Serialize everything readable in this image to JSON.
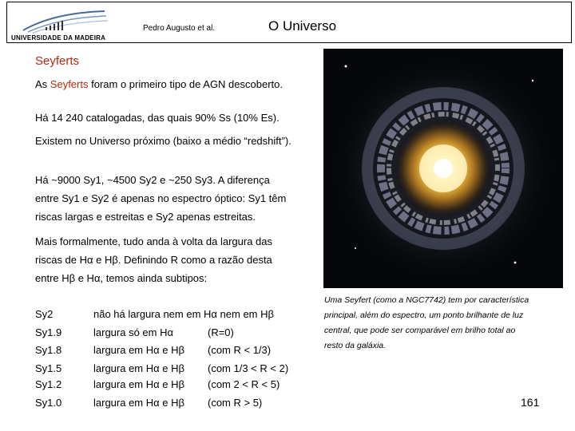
{
  "header": {
    "logo_text": "UNIVERSIDADE DA MADEIRA",
    "author": "Pedro Augusto et al.",
    "title": "O Universo"
  },
  "section_title": "Seyferts",
  "paragraphs": {
    "p1_pre": "As ",
    "p1_highlight": "Seyferts",
    "p1_post": " foram o primeiro tipo de AGN descoberto.",
    "p2": "Há 14 240 catalogadas, das quais 90% Ss (10% Es).",
    "p3": "Existem no Universo próximo (baixo a médio “redshift”).",
    "p4_lines": [
      "Há ~9000 Sy1, ~4500 Sy2 e ~250 Sy3. A diferença",
      "entre Sy1 e Sy2 é apenas no espectro óptico: Sy1 têm",
      "riscas largas e estreitas e Sy2 apenas estreitas."
    ],
    "p5_lines": [
      "Mais formalmente, tudo anda à volta da largura das",
      "riscas de Hα e Hβ. Definindo R como a razão desta",
      "entre Hβ e Hα, temos ainda subtipos:"
    ]
  },
  "subtypes": [
    {
      "name": "Sy2",
      "description": "não há largura nem em Hα nem em Hβ",
      "ratio": ""
    },
    {
      "name": "Sy1.9",
      "description": "largura só em Hα",
      "ratio": "(R=0)"
    },
    {
      "name": "Sy1.8",
      "description": "largura em Hα e Hβ",
      "ratio": "(com R < 1/3)"
    },
    {
      "name": "Sy1.5",
      "description": "largura em Hα e Hβ",
      "ratio": "(com 1/3 < R < 2)"
    },
    {
      "name": "Sy1.2",
      "description": "largura em Hα e Hβ",
      "ratio": "(com 2 < R < 5)"
    },
    {
      "name": "Sy1.0",
      "description": "largura em Hα e Hβ",
      "ratio": "(com R > 5)"
    }
  ],
  "caption_lines": [
    "Uma Seyfert (como a NGC7742) tem por característica",
    "principal, além do espectro, um ponto brilhante de luz",
    "central, que pode ser comparável em brilho total ao",
    "resto da galáxia."
  ],
  "page_number": "161",
  "colors": {
    "highlight": "#b22a10",
    "photo_background": "#05070a"
  }
}
